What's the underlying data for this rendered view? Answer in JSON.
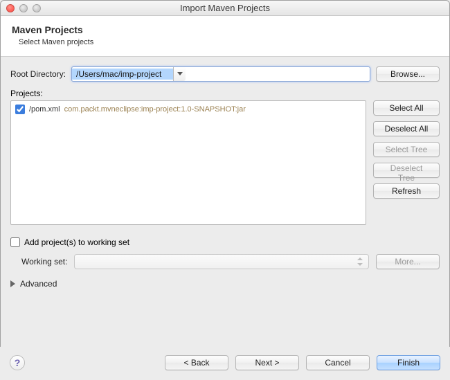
{
  "window": {
    "title": "Import Maven Projects"
  },
  "header": {
    "title": "Maven Projects",
    "subtitle": "Select Maven projects"
  },
  "root_dir": {
    "label": "Root Directory:",
    "value": "/Users/mac/imp-project"
  },
  "browse_label": "Browse...",
  "projects_label": "Projects:",
  "projects": [
    {
      "checked": true,
      "path": "/pom.xml",
      "gav": "com.packt.mvneclipse:imp-project:1.0-SNAPSHOT:jar"
    }
  ],
  "side_buttons": {
    "select_all": "Select All",
    "deselect_all": "Deselect All",
    "select_tree": "Select Tree",
    "deselect_tree": "Deselect Tree",
    "refresh": "Refresh"
  },
  "working_set": {
    "checkbox_label": "Add project(s) to working set",
    "checked": false,
    "label": "Working set:",
    "more_label": "More..."
  },
  "advanced_label": "Advanced",
  "footer": {
    "back": "< Back",
    "next": "Next >",
    "cancel": "Cancel",
    "finish": "Finish"
  }
}
